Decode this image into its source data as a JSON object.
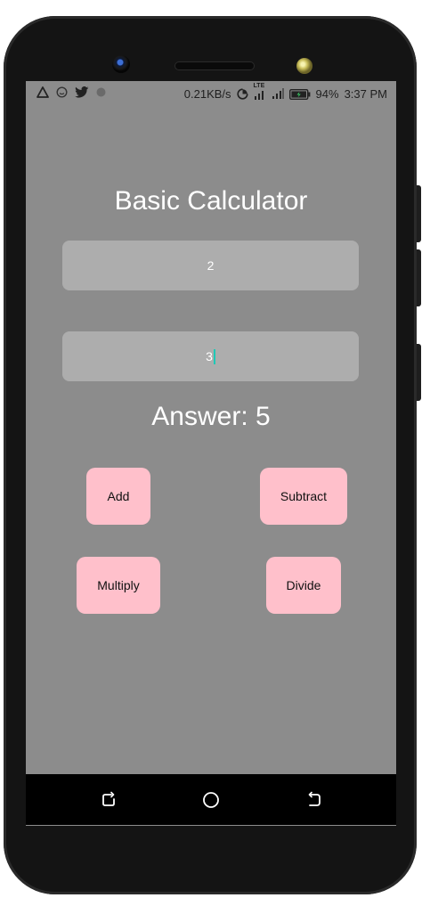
{
  "status_bar": {
    "network_speed": "0.21KB/s",
    "network_type": "LTE",
    "battery": "94%",
    "time": "3:37 PM",
    "icons": [
      "alert-triangle-icon",
      "smiley-icon",
      "twitter-bird-icon",
      "dot-icon",
      "data-saver-icon",
      "signal-icon",
      "battery-icon"
    ]
  },
  "app": {
    "title": "Basic Calculator",
    "first_input_value": "2",
    "second_input_value": "3",
    "answer_text": "Answer: 5",
    "cursor_color": "#1ec9b7"
  },
  "buttons": {
    "add": "Add",
    "subtract": "Subtract",
    "multiply": "Multiply",
    "divide": "Divide",
    "color": "#ffc0cb"
  },
  "nav_bar": {
    "icons": [
      "recent-apps-icon",
      "home-icon",
      "back-icon"
    ]
  },
  "colors": {
    "screen_background": "#8c8c8c",
    "input_background": "#adadad",
    "text": "#ffffff"
  }
}
